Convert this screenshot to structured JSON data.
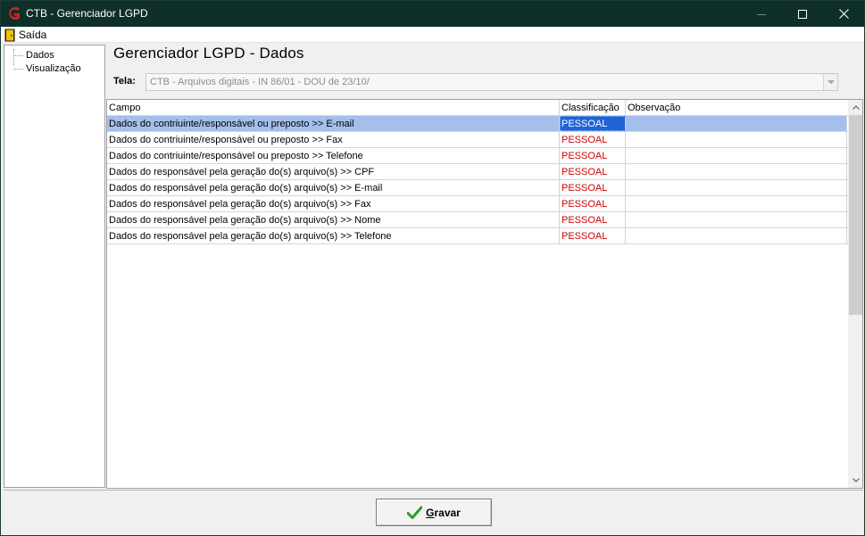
{
  "window": {
    "title": "CTB - Gerenciador LGPD",
    "controls": {
      "minimize": "minimize-icon",
      "maximize": "maximize-icon",
      "close": "close-icon"
    }
  },
  "menu": {
    "exit_label": "Saída"
  },
  "tree": {
    "items": [
      {
        "label": "Dados"
      },
      {
        "label": "Visualização"
      }
    ]
  },
  "page": {
    "title": "Gerenciador LGPD - Dados"
  },
  "tela": {
    "label": "Tela:",
    "value": "CTB - Arquivos digitais - IN 86/01 - DOU de 23/10/"
  },
  "grid": {
    "columns": [
      "Campo",
      "Classificação",
      "Observação"
    ],
    "rows": [
      {
        "campo": "Dados do contriuinte/responsável ou preposto >> E-mail",
        "classificacao": "PESSOAL",
        "observacao": ""
      },
      {
        "campo": "Dados do contriuinte/responsável ou preposto >> Fax",
        "classificacao": "PESSOAL",
        "observacao": ""
      },
      {
        "campo": "Dados do contriuinte/responsável ou preposto >> Telefone",
        "classificacao": "PESSOAL",
        "observacao": ""
      },
      {
        "campo": "Dados do responsável pela geração do(s) arquivo(s) >> CPF",
        "classificacao": "PESSOAL",
        "observacao": ""
      },
      {
        "campo": "Dados do responsável pela geração do(s) arquivo(s) >> E-mail",
        "classificacao": "PESSOAL",
        "observacao": ""
      },
      {
        "campo": "Dados do responsável pela geração do(s) arquivo(s) >> Fax",
        "classificacao": "PESSOAL",
        "observacao": ""
      },
      {
        "campo": "Dados do responsável pela geração do(s) arquivo(s) >> Nome",
        "classificacao": "PESSOAL",
        "observacao": ""
      },
      {
        "campo": "Dados do responsável pela geração do(s) arquivo(s) >> Telefone",
        "classificacao": "PESSOAL",
        "observacao": ""
      }
    ],
    "selected_row": 0
  },
  "footer": {
    "save_label_first": "G",
    "save_label_rest": "ravar"
  },
  "colors": {
    "titlebar": "#0f2f2a",
    "classification_text": "#d40000",
    "selected_row": "#a4bfeb",
    "selected_cell": "#1f63d6",
    "check": "#2e9a2e"
  }
}
